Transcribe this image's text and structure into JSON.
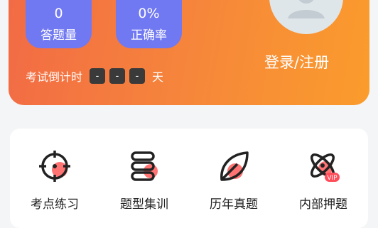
{
  "stats": [
    {
      "value": "0",
      "label": "答题量"
    },
    {
      "value": "0%",
      "label": "正确率"
    }
  ],
  "countdown": {
    "label": "考试倒计时",
    "boxes": [
      "-",
      "-",
      "-"
    ],
    "unit": "天"
  },
  "login_label": "登录/注册",
  "menu": [
    {
      "label": "考点练习",
      "icon": "target-icon"
    },
    {
      "label": "题型集训",
      "icon": "stack-icon"
    },
    {
      "label": "历年真题",
      "icon": "leaf-icon"
    },
    {
      "label": "内部押题",
      "icon": "atom-vip-icon",
      "badge": "VIP"
    }
  ],
  "colors": {
    "accent": "#f26a45",
    "stat_bg": "#7078f2",
    "icon_dot": "#ff5a5a"
  }
}
